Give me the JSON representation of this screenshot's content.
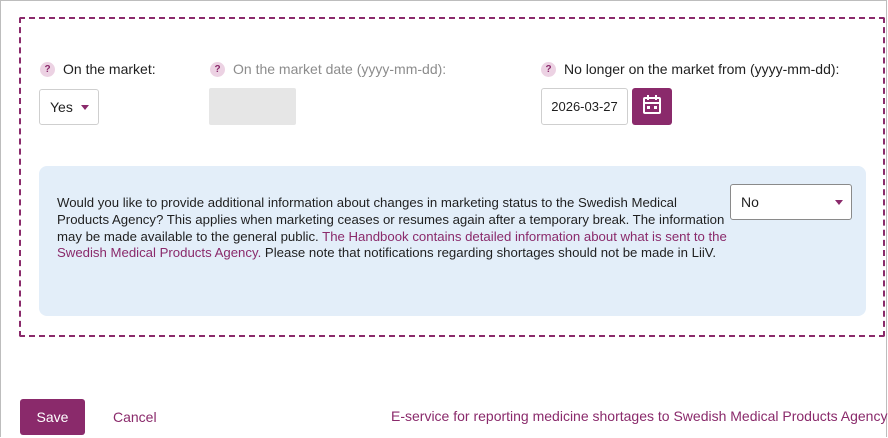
{
  "fields": {
    "on_market": {
      "label": "On the market:",
      "value": "Yes",
      "help": "?"
    },
    "on_market_date": {
      "label": "On the market date (yyyy-mm-dd):",
      "help": "?"
    },
    "no_longer_on_market": {
      "label": "No longer on the market from (yyyy-mm-dd):",
      "value": "2026-03-27",
      "help": "?"
    }
  },
  "info": {
    "text_before": "Would you like to provide additional information about changes in marketing status to the Swedish Medical Products Agency? This applies when marketing ceases or resumes again after a temporary break. The information may be made available to the general public. ",
    "link": "The Handbook contains detailed information about what is sent to the Swedish Medical Products Agency.",
    "text_after": " Please note that notifications regarding shortages should not be made in LiiV.",
    "select_value": "No"
  },
  "footer": {
    "save_label": "Save",
    "cancel_label": "Cancel",
    "eservice_link": "E-service for reporting medicine shortages to Swedish Medical Products Agency"
  },
  "colors": {
    "accent": "#8a2a6b",
    "info_bg": "#e3eef9",
    "disabled_bg": "#e6e6e6"
  },
  "icons": [
    "help-icon",
    "calendar-icon",
    "caret-down-icon"
  ]
}
